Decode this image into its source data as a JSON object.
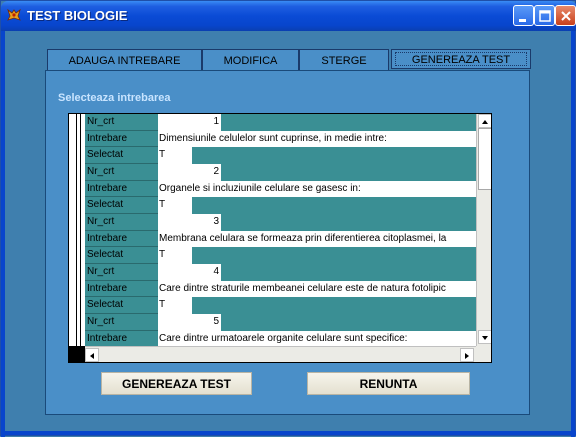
{
  "window": {
    "title": "TEST BIOLOGIE",
    "title_color": "#ffffff",
    "titlebar_color": "#0a4bd6",
    "client_bg": "#3f7fae"
  },
  "tabs": [
    {
      "label": "ADAUGA INTREBARE",
      "active": false
    },
    {
      "label": "MODIFICA",
      "active": false
    },
    {
      "label": "STERGE",
      "active": false
    },
    {
      "label": "GENEREAZA TEST",
      "active": true
    }
  ],
  "section_title": "Selecteaza intrebarea",
  "grid": {
    "field_labels": {
      "nr": "Nr_crt",
      "intrebare": "Intrebare",
      "selectat": "Selectat"
    },
    "accent_color": "#3a8f94",
    "records": [
      {
        "nr": "1",
        "intrebare": "Dimensiunile celulelor sunt cuprinse, in medie intre:",
        "selectat": "T"
      },
      {
        "nr": "2",
        "intrebare": "Organele si incluziunile celulare se gasesc in:",
        "selectat": "T"
      },
      {
        "nr": "3",
        "intrebare": "Membrana celulara se formeaza prin diferentierea citoplasmei, la",
        "selectat": "T"
      },
      {
        "nr": "4",
        "intrebare": "Care dintre straturile membeanei celulare este de natura fotolipic",
        "selectat": "T"
      },
      {
        "nr": "5",
        "intrebare": "Care dintre urmatoarele organite celulare sunt specifice:",
        "selectat": ""
      }
    ]
  },
  "buttons": {
    "generate": "GENEREAZA TEST",
    "cancel": "RENUNTA"
  }
}
